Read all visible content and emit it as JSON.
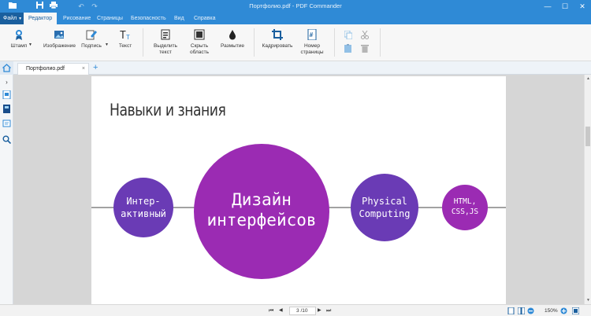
{
  "titlebar": {
    "title": "Портфолио.pdf - PDF Commander",
    "minimize": "—",
    "maximize": "☐",
    "close": "✕"
  },
  "ribbon_tabs": {
    "file": "Файл",
    "items": [
      "Редактор",
      "Рисование",
      "Страницы",
      "Безопасность",
      "Вид",
      "Справка"
    ],
    "active_index": 0
  },
  "ribbon": {
    "stamp": "Штамп",
    "image": "Изображение",
    "signature": "Подпись",
    "text": "Текст",
    "highlight_line1": "Выделить",
    "highlight_line2": "текст",
    "hide_line1": "Скрыть",
    "hide_line2": "область",
    "blur": "Размытие",
    "crop": "Кадрировать",
    "pagenum_line1": "Номер",
    "pagenum_line2": "страницы"
  },
  "document_tab": {
    "name": "Портфолио.pdf",
    "close": "×",
    "add": "+"
  },
  "page": {
    "title": "Навыки и знания",
    "circles": [
      {
        "line1": "Интер-",
        "line2": "активный",
        "color": "#6a3bb5"
      },
      {
        "line1": "Дизайн",
        "line2": "интерфейсов",
        "color": "#9b2bb3"
      },
      {
        "line1": "Physical",
        "line2": "Computing",
        "color": "#6a3bb5"
      },
      {
        "line1": "HTML,",
        "line2": "CSS,JS",
        "color": "#9b2bb3"
      }
    ]
  },
  "statusbar": {
    "current_page": "3",
    "total_pages": "/10",
    "zoom": "150%"
  },
  "colors": {
    "accent": "#2f8ad6",
    "accent_dark": "#1a5f9e"
  }
}
